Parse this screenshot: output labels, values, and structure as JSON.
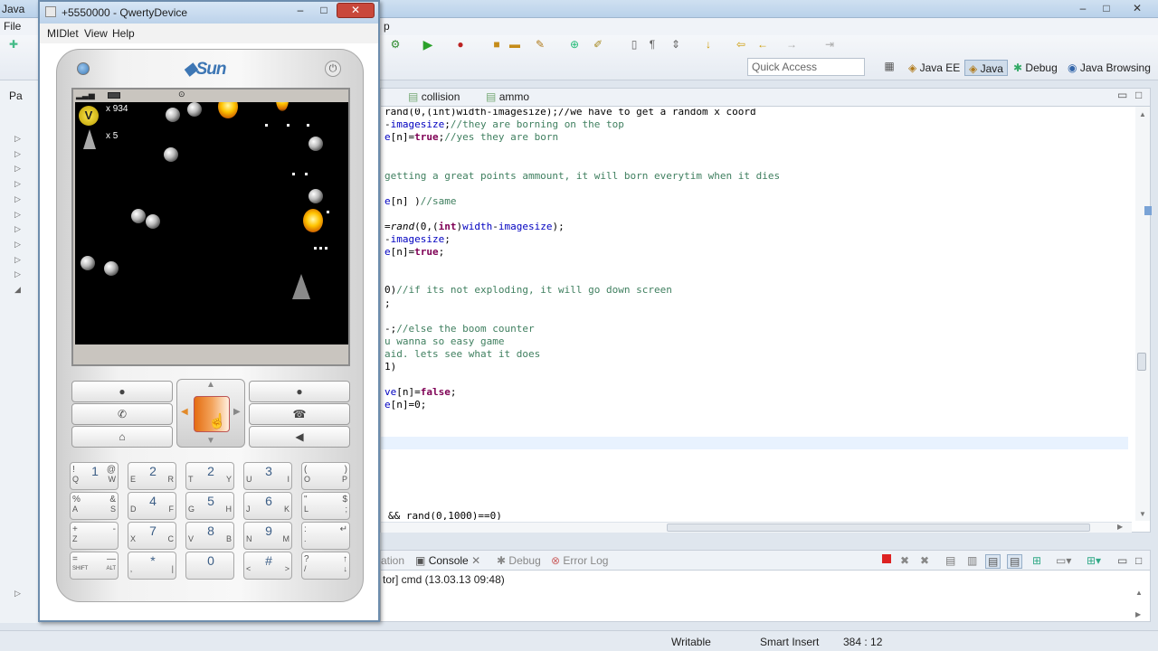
{
  "eclipse": {
    "title_fragment": "Java",
    "menu_items": [
      "File",
      "p"
    ],
    "quick_access_placeholder": "Quick Access",
    "perspectives": [
      "Java EE",
      "Java",
      "Debug",
      "Java Browsing"
    ],
    "left_label": "Pa",
    "editor_tabs": [
      "collision",
      "ammo"
    ],
    "code_lines": [
      {
        "segments": [
          {
            "t": "rand(0,(int)width-imagesize);//we have to get a random x coord",
            "s": "plain"
          }
        ]
      },
      {
        "segments": [
          {
            "t": "-",
            "s": "plain"
          },
          {
            "t": "imagesize",
            "s": "vr"
          },
          {
            "t": ";",
            "s": "plain"
          },
          {
            "t": "//they are borning on the top",
            "s": "cm"
          }
        ]
      },
      {
        "segments": [
          {
            "t": "e",
            "s": "vr"
          },
          {
            "t": "[n]=",
            "s": "plain"
          },
          {
            "t": "true",
            "s": "kw"
          },
          {
            "t": ";",
            "s": "plain"
          },
          {
            "t": "//yes they are born",
            "s": "cm"
          }
        ]
      },
      {
        "segments": []
      },
      {
        "segments": []
      },
      {
        "segments": [
          {
            "t": "getting a great points ammount, it will born everytim when it dies",
            "s": "cm"
          }
        ]
      },
      {
        "segments": []
      },
      {
        "segments": [
          {
            "t": "e",
            "s": "vr"
          },
          {
            "t": "[n] )",
            "s": "plain"
          },
          {
            "t": "//same",
            "s": "cm"
          }
        ]
      },
      {
        "segments": []
      },
      {
        "segments": [
          {
            "t": "=",
            "s": "plain"
          },
          {
            "t": "rand",
            "s": "it"
          },
          {
            "t": "(0,(",
            "s": "plain"
          },
          {
            "t": "int",
            "s": "kw"
          },
          {
            "t": ")",
            "s": "plain"
          },
          {
            "t": "width",
            "s": "vr"
          },
          {
            "t": "-",
            "s": "plain"
          },
          {
            "t": "imagesize",
            "s": "vr"
          },
          {
            "t": ");",
            "s": "plain"
          }
        ]
      },
      {
        "segments": [
          {
            "t": "-",
            "s": "plain"
          },
          {
            "t": "imagesize",
            "s": "vr"
          },
          {
            "t": ";",
            "s": "plain"
          }
        ]
      },
      {
        "segments": [
          {
            "t": "e",
            "s": "vr"
          },
          {
            "t": "[n]=",
            "s": "plain"
          },
          {
            "t": "true",
            "s": "kw"
          },
          {
            "t": ";",
            "s": "plain"
          }
        ]
      },
      {
        "segments": []
      },
      {
        "segments": []
      },
      {
        "segments": [
          {
            "t": "0)",
            "s": "plain"
          },
          {
            "t": "//if its not exploding, it will go down screen",
            "s": "cm"
          }
        ]
      },
      {
        "segments": [
          {
            "t": ";",
            "s": "plain"
          }
        ]
      },
      {
        "segments": []
      },
      {
        "segments": [
          {
            "t": "-;",
            "s": "plain"
          },
          {
            "t": "//else the boom counter",
            "s": "cm"
          }
        ]
      },
      {
        "segments": [
          {
            "t": "u wanna so easy game",
            "s": "cm"
          }
        ]
      },
      {
        "segments": [
          {
            "t": "aid. lets see what it does",
            "s": "cm"
          }
        ]
      },
      {
        "segments": [
          {
            "t": "1)",
            "s": "plain"
          }
        ]
      },
      {
        "segments": []
      },
      {
        "segments": [
          {
            "t": "ve",
            "s": "vr"
          },
          {
            "t": "[n]=",
            "s": "plain"
          },
          {
            "t": "false",
            "s": "kw"
          },
          {
            "t": ";",
            "s": "plain"
          }
        ]
      },
      {
        "segments": [
          {
            "t": "e",
            "s": "vr"
          },
          {
            "t": "[n]=0;",
            "s": "plain"
          }
        ]
      }
    ],
    "last_code_line": "&& rand(0,1000)==0)",
    "console_tabs": [
      "ation",
      "Console",
      "Debug",
      "Error Log"
    ],
    "console_text": "tor] cmd (13.03.13 09:48)",
    "status": {
      "writable": "Writable",
      "insert_mode": "Smart Insert",
      "position": "384 : 12"
    }
  },
  "emulator": {
    "title": "+5550000 - QwertyDevice",
    "menu": [
      "MIDlet",
      "View",
      "Help"
    ],
    "brand": "Sun",
    "score_text": "x 934",
    "lives_text": "x 5",
    "keypad": [
      {
        "main": "1",
        "tl": "!",
        "tr": "@",
        "bl": "Q",
        "br": "W"
      },
      {
        "main": "2",
        "tl": "",
        "tr": "",
        "bl": "E",
        "br": "R"
      },
      {
        "main": "2",
        "tl": "",
        "tr": "",
        "bl": "T",
        "br": "Y"
      },
      {
        "main": "3",
        "tl": "",
        "tr": "",
        "bl": "U",
        "br": "I"
      },
      {
        "main": "",
        "tl": "(",
        "tr": ")",
        "bl": "O",
        "br": "P"
      },
      {
        "main": "",
        "tl": "%",
        "tr": "&",
        "bl": "A",
        "br": "S"
      },
      {
        "main": "4",
        "tl": "",
        "tr": "",
        "bl": "D",
        "br": "F"
      },
      {
        "main": "5",
        "tl": "",
        "tr": "",
        "bl": "G",
        "br": "H"
      },
      {
        "main": "6",
        "tl": "",
        "tr": "",
        "bl": "J",
        "br": "K"
      },
      {
        "main": "",
        "tl": "\"",
        "tr": "$",
        "bl": "L",
        "br": ";"
      },
      {
        "main": "",
        "tl": "+",
        "tr": "-",
        "bl": "Z",
        "br": ""
      },
      {
        "main": "7",
        "tl": "",
        "tr": "",
        "bl": "X",
        "br": "C"
      },
      {
        "main": "8",
        "tl": "",
        "tr": "",
        "bl": "V",
        "br": "B"
      },
      {
        "main": "9",
        "tl": "",
        "tr": "",
        "bl": "N",
        "br": "M"
      },
      {
        "main": "",
        "tl": ":",
        "tr": "↵",
        "bl": ".",
        "br": ""
      },
      {
        "main": "",
        "tl": "=",
        "tr": "—",
        "bl": "SHIFT",
        "br": "ALT"
      },
      {
        "main": "*",
        "tl": "",
        "tr": "",
        "bl": "‚",
        "br": "|"
      },
      {
        "main": "0",
        "tl": "",
        "tr": "",
        "bl": "",
        "br": ""
      },
      {
        "main": "#",
        "tl": "",
        "tr": "",
        "bl": "<",
        "br": ">"
      },
      {
        "main": "",
        "tl": "?",
        "tr": "↑",
        "bl": "/",
        "br": "↓"
      }
    ]
  }
}
